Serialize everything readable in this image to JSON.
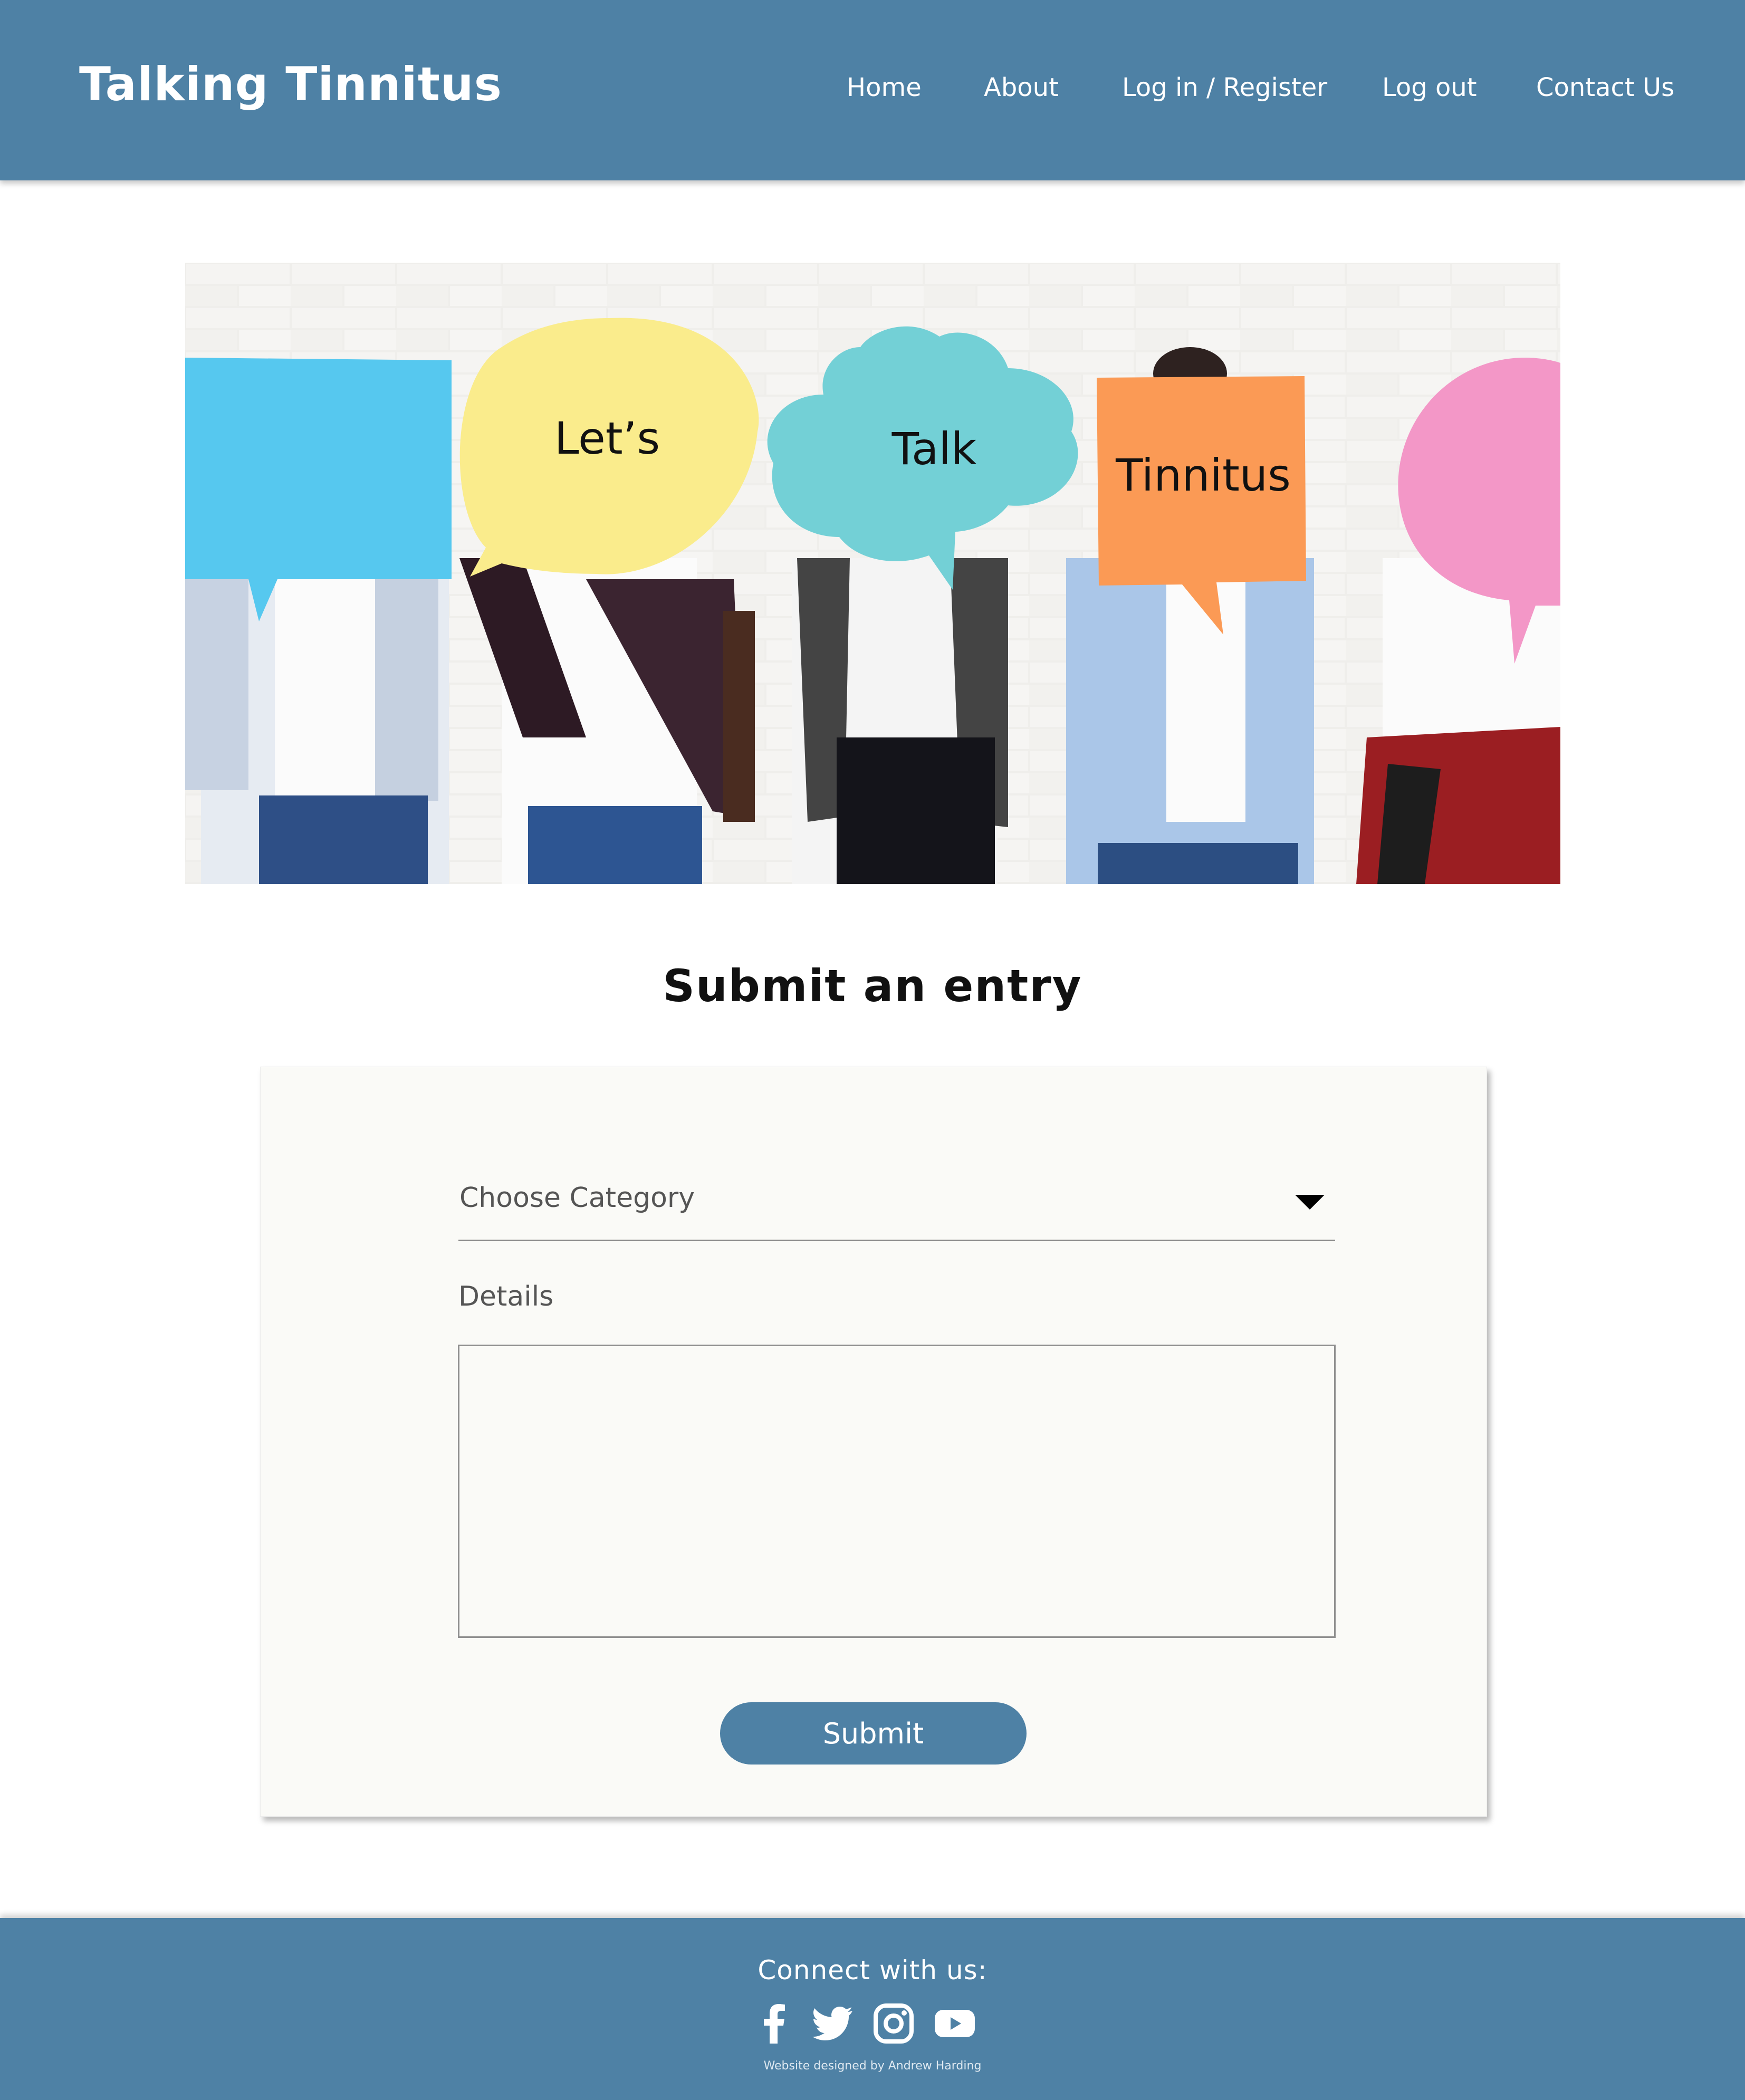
{
  "header": {
    "brand": "Talking Tinnitus",
    "nav": [
      {
        "label": "Home"
      },
      {
        "label": "About"
      },
      {
        "label": "Log in / Register"
      },
      {
        "label": "Log out"
      },
      {
        "label": "Contact Us"
      }
    ]
  },
  "hero": {
    "bubbles": [
      "Let’s",
      "Talk",
      "Tinnitus"
    ]
  },
  "main": {
    "title": "Submit an entry"
  },
  "form": {
    "category_placeholder": "Choose Category",
    "details_label": "Details",
    "details_value": "",
    "submit_label": "Submit"
  },
  "footer": {
    "connect_label": "Connect with us:",
    "social_icons": [
      "facebook-icon",
      "twitter-icon",
      "instagram-icon",
      "youtube-icon"
    ],
    "credit": "Website designed by Andrew Harding"
  },
  "colors": {
    "brand_blue": "#4e81a5",
    "card_background": "#fafaf7",
    "bubble_blue": "#56c8ef",
    "bubble_yellow": "#faec8c",
    "bubble_teal": "#73d0d6",
    "bubble_orange": "#fb9a55",
    "bubble_pink": "#f397c7"
  }
}
